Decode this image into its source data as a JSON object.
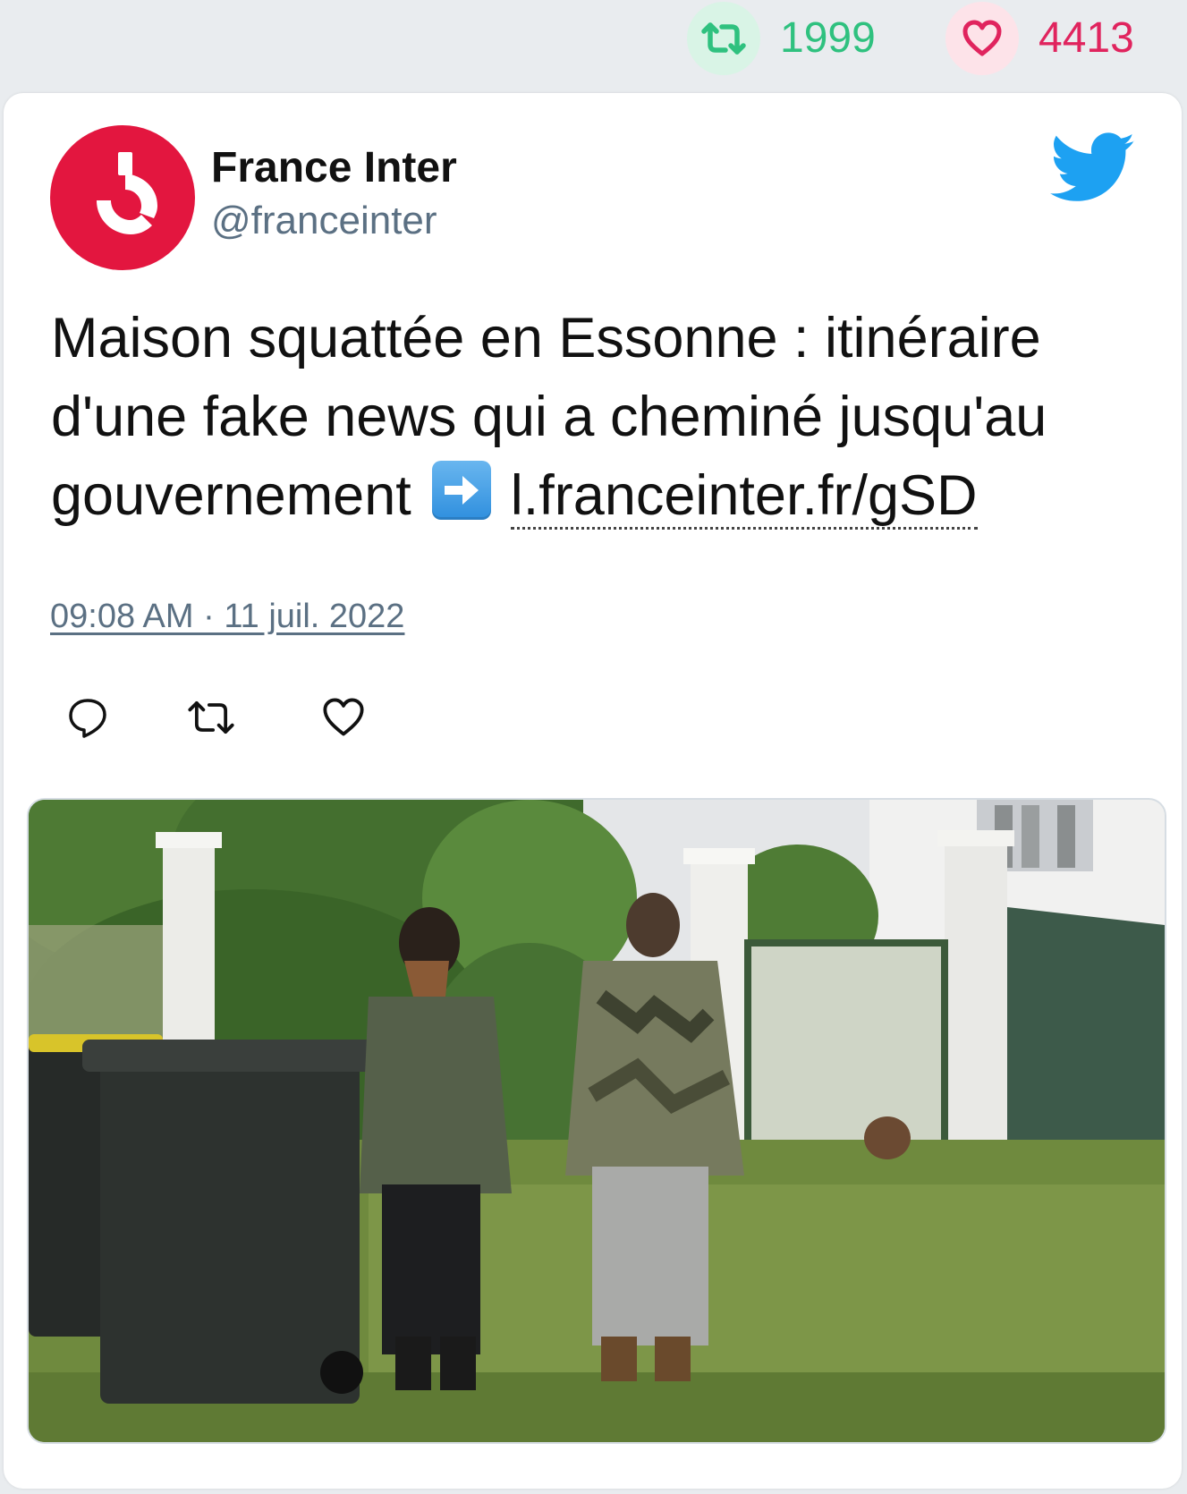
{
  "stats": {
    "retweets": "1999",
    "likes": "4413",
    "retweet_color": "#2fc17f",
    "like_color": "#e0245e"
  },
  "tweet": {
    "author_name": "France Inter",
    "handle": "@franceinter",
    "text": "Maison squattée en Essonne : itinéraire d'une fake news qui a cheminé jusqu'au gouvernement",
    "link": "l.franceinter.fr/gSD",
    "timestamp": "09:08 AM · 11 juil. 2022",
    "brand_color": "#e3163f",
    "twitter_color": "#1da1f2"
  },
  "icons": {
    "retweet_stat": "retweet-icon",
    "like_stat": "heart-icon",
    "logo": "twitter-bird-icon",
    "arrow": "right-arrow-emoji-icon",
    "actions": [
      "reply-icon",
      "retweet-icon",
      "like-icon"
    ]
  }
}
